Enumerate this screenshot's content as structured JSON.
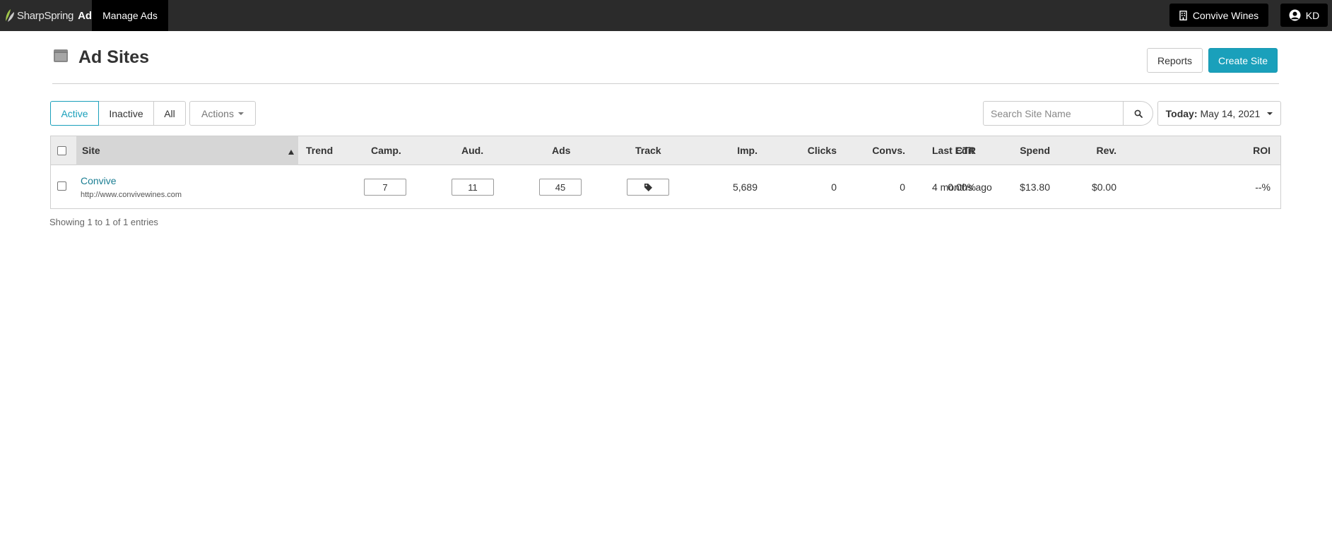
{
  "topbar": {
    "brand_name": "SharpSpring",
    "brand_suffix": "Ads",
    "nav_manage": "Manage Ads",
    "account": "Convive Wines",
    "user_initials": "KD"
  },
  "page": {
    "title": "Ad Sites",
    "reports_label": "Reports",
    "create_label": "Create Site"
  },
  "filters": {
    "active": "Active",
    "inactive": "Inactive",
    "all": "All",
    "actions": "Actions",
    "search_placeholder": "Search Site Name",
    "date_prefix": "Today:",
    "date_value": "May 14, 2021"
  },
  "table": {
    "columns": {
      "site": "Site",
      "trend": "Trend",
      "camp": "Camp.",
      "aud": "Aud.",
      "ads": "Ads",
      "track": "Track",
      "imp": "Imp.",
      "clicks": "Clicks",
      "convs": "Convs.",
      "ctr": "CTR",
      "spend": "Spend",
      "rev": "Rev.",
      "last_edit": "Last Edit",
      "roi": "ROI"
    },
    "rows": [
      {
        "site": "Convive",
        "url": "http://www.convivewines.com",
        "camp": "7",
        "aud": "11",
        "ads": "45",
        "imp": "5,689",
        "clicks": "0",
        "convs": "0",
        "ctr": "0.00%",
        "spend": "$13.80",
        "rev": "$0.00",
        "last_edit": "4 months ago",
        "roi": "--%"
      }
    ],
    "footer": "Showing 1 to 1 of 1 entries"
  },
  "colors": {
    "topbar": "#2b2b2b",
    "accent": "#1aa0bb",
    "link": "#1b7e93"
  }
}
